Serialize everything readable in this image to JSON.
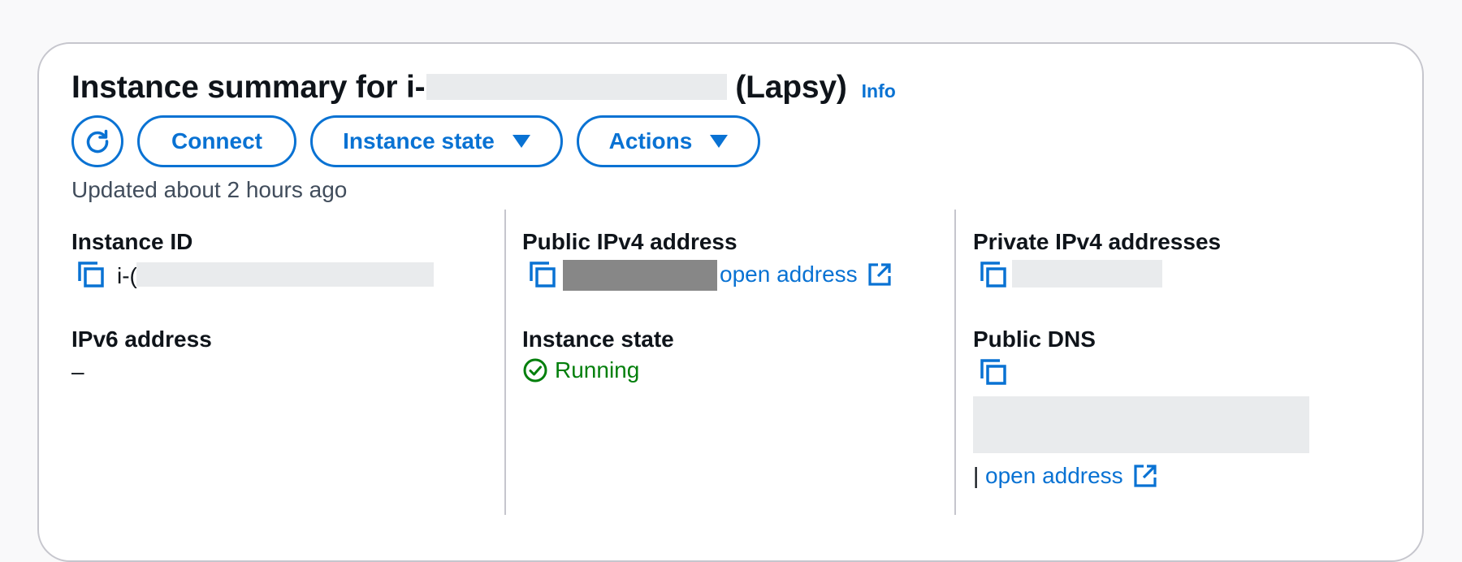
{
  "summary": {
    "title_prefix": "Instance summary for i-",
    "title_suffix": "(Lapsy)",
    "info_label": "Info",
    "updated_text": "Updated about 2 hours ago"
  },
  "toolbar": {
    "refresh_icon": "refresh-icon",
    "connect_label": "Connect",
    "instance_state_label": "Instance state",
    "actions_label": "Actions"
  },
  "details": {
    "instance_id": {
      "label": "Instance ID",
      "value_prefix": "i-("
    },
    "ipv6": {
      "label": "IPv6 address",
      "value": "–"
    },
    "public_ipv4": {
      "label": "Public IPv4 address",
      "link": "open address"
    },
    "instance_state": {
      "label": "Instance state",
      "value": "Running",
      "color": "#037f0c"
    },
    "private_ipv4": {
      "label": "Private IPv4 addresses"
    },
    "public_dns": {
      "label": "Public DNS",
      "separator": "|",
      "link": "open address"
    }
  },
  "colors": {
    "accent": "#0972d3",
    "success": "#037f0c",
    "text": "#0f141a",
    "muted": "#414d5c",
    "border": "#c6c6cd",
    "redaction_light": "#e9ebed",
    "redaction_dark": "#878787"
  }
}
